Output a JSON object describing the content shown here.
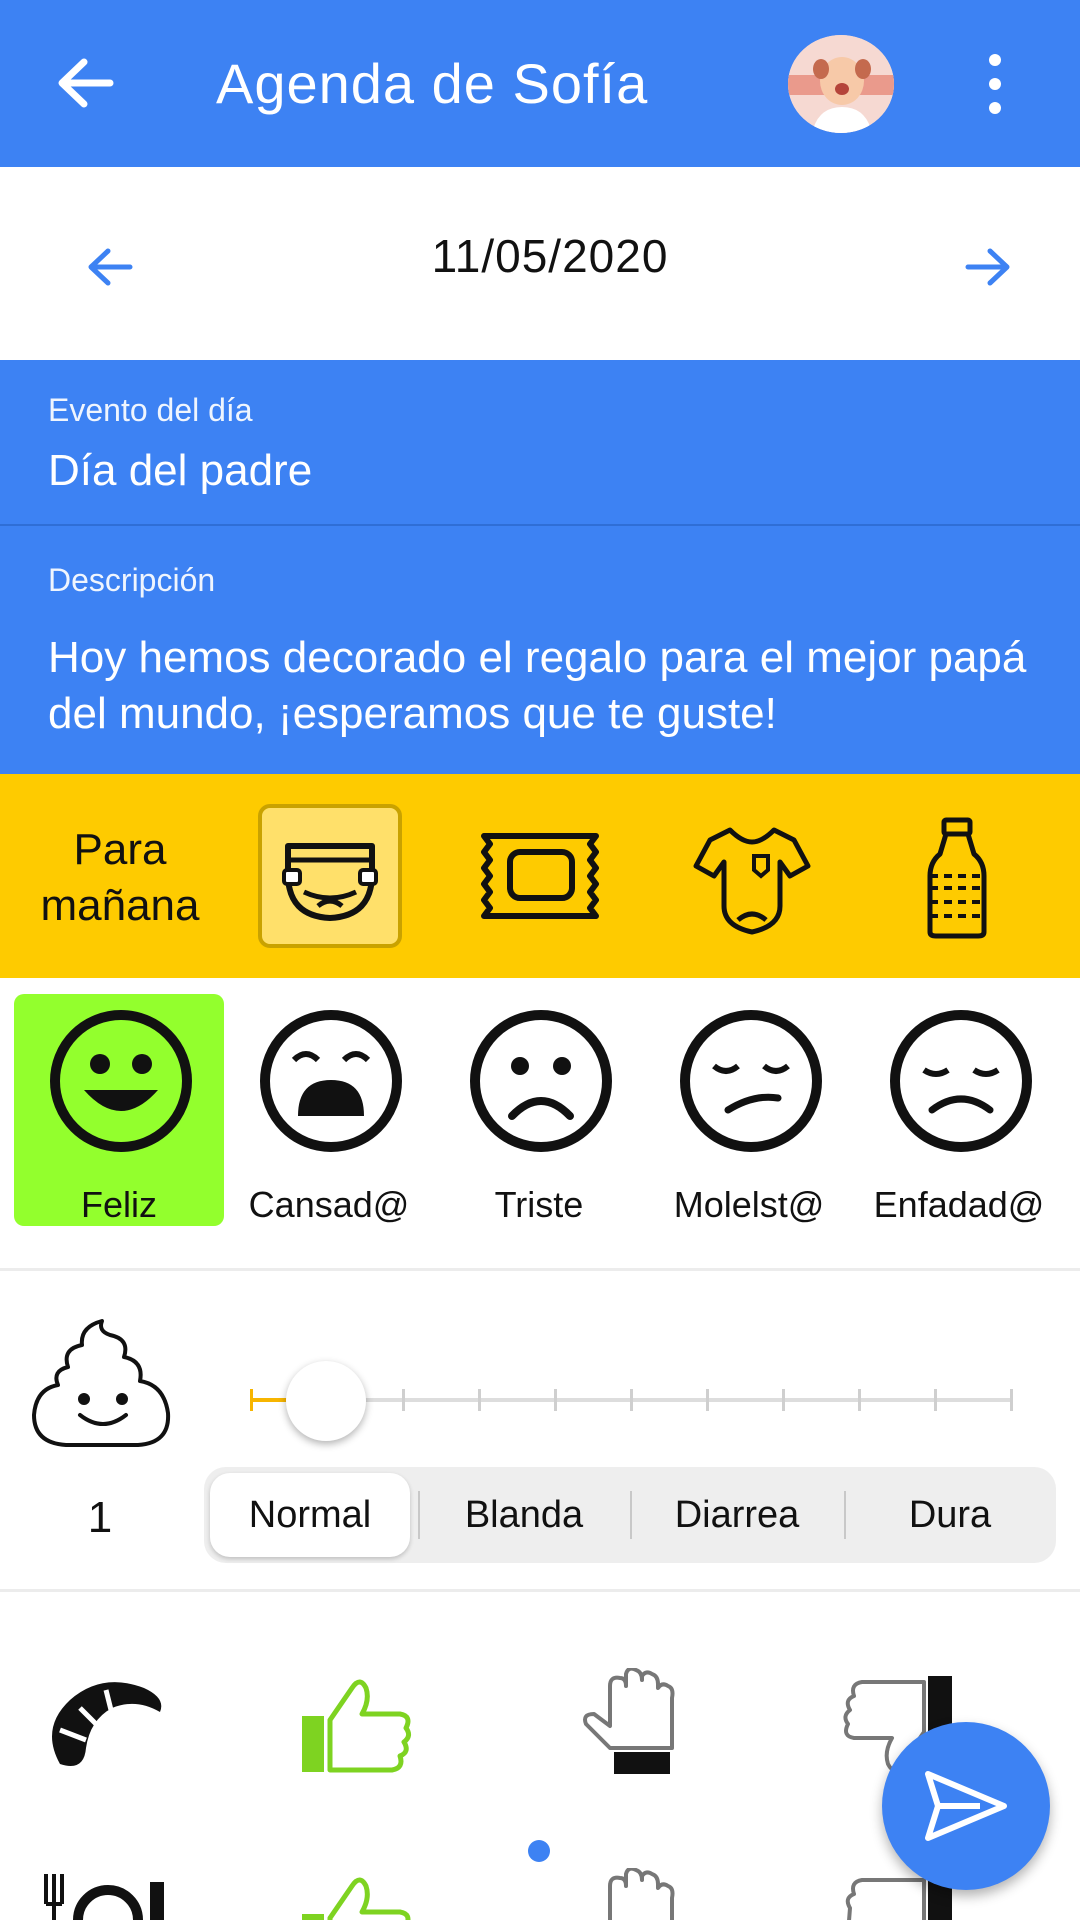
{
  "appbar": {
    "title": "Agenda de Sofía"
  },
  "date": {
    "value": "11/05/2020"
  },
  "event": {
    "label": "Evento del día",
    "value": "Día del padre"
  },
  "description": {
    "label": "Descripción",
    "value": "Hoy hemos decorado el regalo para el mejor papá del mundo, ¡esperamos que te guste!"
  },
  "tomorrow": {
    "label": "Para mañana",
    "items": [
      {
        "icon": "diaper-icon",
        "selected": true
      },
      {
        "icon": "wipes-icon",
        "selected": false
      },
      {
        "icon": "bodysuit-icon",
        "selected": false
      },
      {
        "icon": "water-bottle-icon",
        "selected": false
      }
    ]
  },
  "moods": {
    "items": [
      {
        "label": "Feliz",
        "selected": true
      },
      {
        "label": "Cansad@",
        "selected": false
      },
      {
        "label": "Triste",
        "selected": false
      },
      {
        "label": "Molelst@",
        "selected": false
      },
      {
        "label": "Enfadad@",
        "selected": false
      }
    ]
  },
  "poop": {
    "count": "1",
    "slider_value": 1,
    "slider_max": 10,
    "types": [
      "Normal",
      "Blanda",
      "Diarrea",
      "Dura"
    ],
    "selected_type": "Normal"
  },
  "colors": {
    "primary": "#3d82f3",
    "yellow": "#fecb00",
    "green": "#93ff2d",
    "thumbs_up": "#7ed321"
  }
}
